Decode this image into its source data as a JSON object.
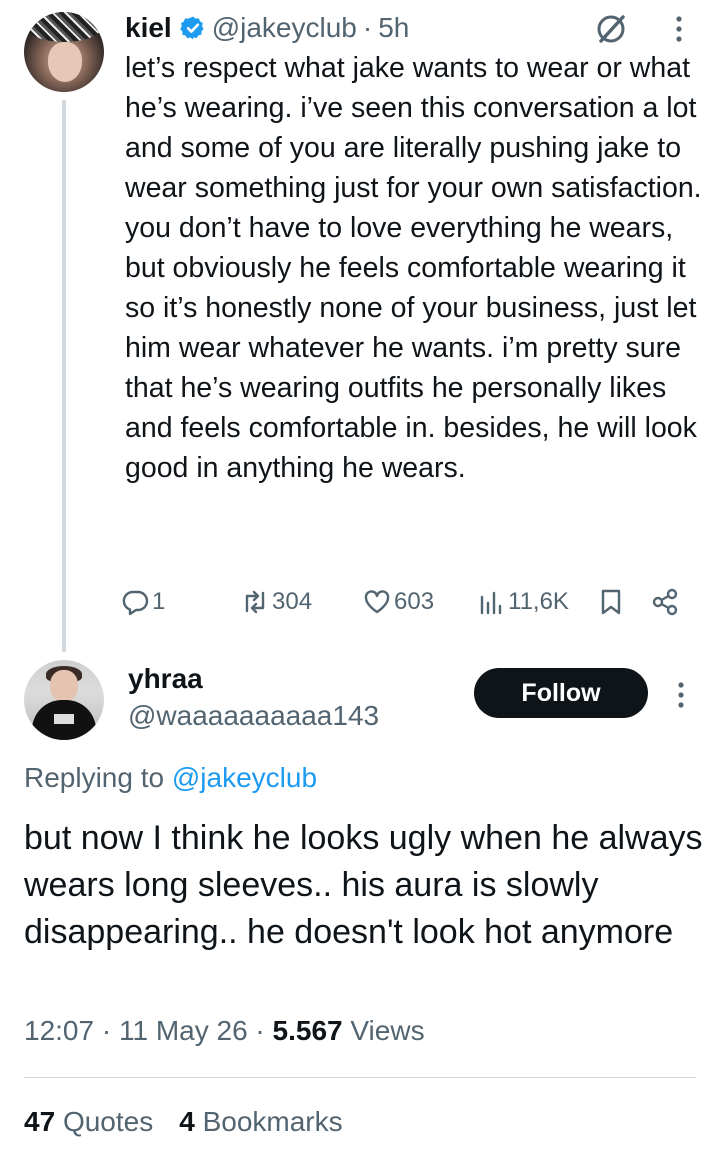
{
  "parent_tweet": {
    "name": "kiel",
    "handle": "@jakeyclub",
    "dot": "·",
    "time": "5h",
    "text": "let’s respect what jake wants to wear or what he’s wearing. i’ve seen this conversation a lot and some of you are literally pushing jake to wear something just for your own satisfaction. you don’t have to love everything he wears, but obviously he feels comfortable wearing it so it’s honestly none of your business, just let him wear whatever he wants. i’m pretty sure that he’s wearing outfits he personally likes and feels comfortable in. besides, he will look good in anything he wears.",
    "replies": "1",
    "retweets": "304",
    "likes": "603",
    "views": "11,6K"
  },
  "main_tweet": {
    "name": "yhraa",
    "handle": "@waaaaaaaaaa143",
    "follow_label": "Follow",
    "replying_prefix": "Replying to",
    "replying_to": "@jakeyclub",
    "text": "but now I think he looks ugly when he always wears long sleeves.. his aura is slowly disappearing.. he doesn't look hot anymore",
    "time": "12:07",
    "sep1": "·",
    "date": "11 May 26",
    "sep2": "·",
    "views_count": "5.567",
    "views_label": "Views",
    "quotes_count": "47",
    "quotes_label": "Quotes",
    "bookmarks_count": "4",
    "bookmarks_label": "Bookmarks"
  },
  "icons": {
    "verified": "verified-badge-icon",
    "grok": "grok-icon",
    "more": "more-vertical-icon",
    "reply": "reply-icon",
    "retweet": "retweet-icon",
    "like": "heart-icon",
    "views": "views-bar-icon",
    "bookmark": "bookmark-icon",
    "share": "share-icon"
  },
  "colors": {
    "text": "#0f1419",
    "secondary": "#536471",
    "accent": "#1d9bf0",
    "button_bg": "#0f1419",
    "divider": "#cfd9de"
  }
}
